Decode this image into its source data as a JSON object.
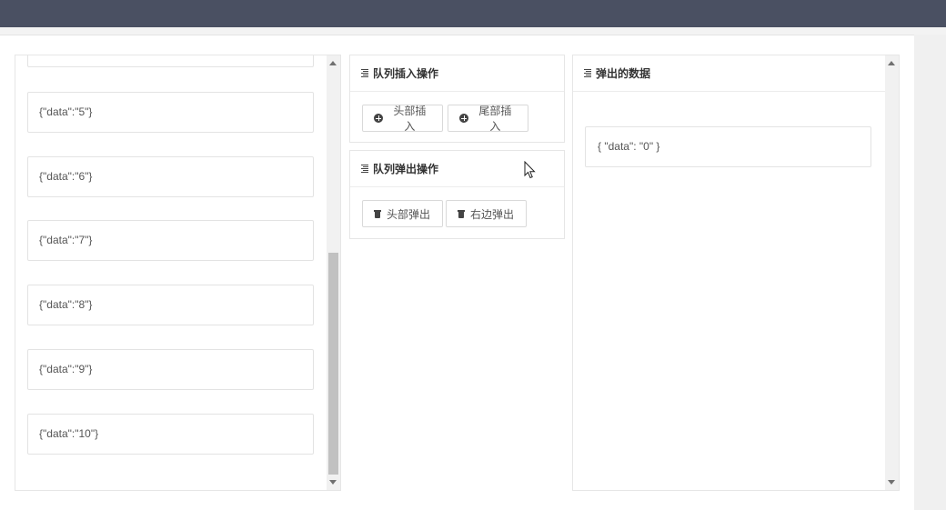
{
  "queue_list": {
    "items": [
      {
        "label": ""
      },
      {
        "label": "{\"data\":\"5\"}"
      },
      {
        "label": "{\"data\":\"6\"}"
      },
      {
        "label": "{\"data\":\"7\"}"
      },
      {
        "label": "{\"data\":\"8\"}"
      },
      {
        "label": "{\"data\":\"9\"}"
      },
      {
        "label": "{\"data\":\"10\"}"
      }
    ]
  },
  "insert_card": {
    "title": "队列插入操作",
    "head_insert_label": "头部插入",
    "tail_insert_label": "尾部插入"
  },
  "pop_card": {
    "title": "队列弹出操作",
    "head_pop_label": "头部弹出",
    "right_pop_label": "右边弹出"
  },
  "popped_card": {
    "title": "弹出的数据",
    "value": "{ \"data\": \"0\" }"
  },
  "colors": {
    "topbar": "#4a5062",
    "panel_border": "#e6e6e6",
    "scroll_thumb": "#c1c1c1"
  },
  "icons": {
    "card_header": "list-icon",
    "insert": "plus-circle-icon",
    "pop": "trash-icon",
    "pointer": "mouse-cursor-icon"
  }
}
